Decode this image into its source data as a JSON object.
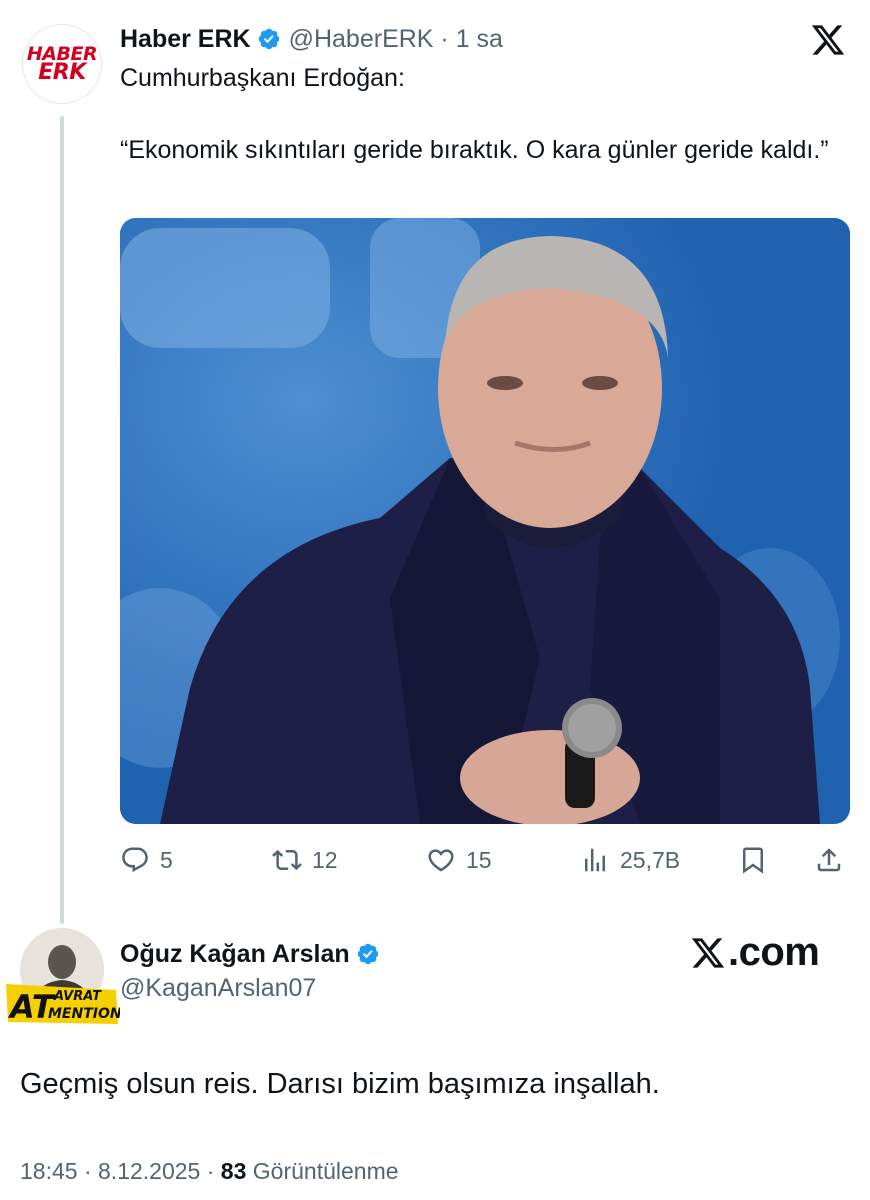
{
  "quoted_tweet": {
    "avatar_text": [
      "HABER",
      "ERK"
    ],
    "author_name": "Haber ERK",
    "verified_icon": "verified-badge-icon",
    "handle": "@HaberERK",
    "separator": "·",
    "time": "1 sa",
    "text_line1": "Cumhurbaşkanı Erdoğan:",
    "text_quote": "“Ekonomik sıkıntıları geride bıraktık. O kara günler geride kaldı.”",
    "image": "photo of a smiling man in a dark coat holding a microphone, blue background",
    "actions": {
      "reply_count": "5",
      "repost_count": "12",
      "like_count": "15",
      "views_count": "25,7B"
    },
    "brand_icon": "x-logo-icon"
  },
  "reply_tweet": {
    "author_name": "Oğuz Kağan Arslan",
    "verified_icon": "verified-badge-icon",
    "handle": "@KaganArslan07",
    "badge_text": [
      "AT",
      "AVRAT",
      "MENTION"
    ],
    "watermark": ".com",
    "text": "Geçmiş olsun reis. Darısı bizim başımıza inşallah.",
    "meta": {
      "time": "18:45",
      "sep": "·",
      "date": "8.12.2025",
      "views_number": "83",
      "views_label": "Görüntülenme"
    }
  },
  "colors": {
    "text": "#0f1419",
    "secondary": "#536471",
    "verified_blue": "#1d9bf0",
    "brand_red": "#d4001f",
    "badge_yellow": "#f5d000",
    "photo_blue": "#1f64b3"
  }
}
